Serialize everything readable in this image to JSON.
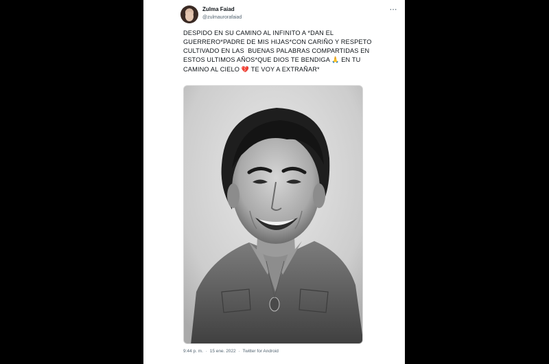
{
  "tweet": {
    "display_name": "Zulma Faiad",
    "handle": "@zulmaurorafaiad",
    "more_icon": "more-dots-icon",
    "text": "DESPIDO EN SU CAMINO AL INFINITO A *DAN EL GUERRERO*PADRE DE MIS HIJAS*CON CARIÑO Y RESPETO CULTIVADO EN LAS  BUENAS PALABRAS COMPARTIDAS EN ESTOS ULTIMOS AÑOS*QUE DIOS TE BENDIGA 🙏 EN TU CAMINO AL CIELO 💔 TE VOY A EXTRAÑAR*",
    "text_parts": {
      "part1": "DESPIDO EN SU CAMINO AL INFINITO A *DAN EL GUERRERO*PADRE DE MIS HIJAS*CON CARIÑO Y RESPETO CULTIVADO EN LAS  BUENAS PALABRAS COMPARTIDAS EN ESTOS ULTIMOS AÑOS*QUE DIOS TE BENDIGA ",
      "emoji1": "🙏",
      "part2": " EN TU CAMINO AL CIELO ",
      "emoji2": "💔",
      "part3": " TE VOY A EXTRAÑAR*"
    },
    "time": "9:44 p. m.",
    "date": "15 ene. 2022",
    "separator": "·",
    "source": "Twitter for Android"
  },
  "media": {
    "kind": "photo",
    "icon": "portrait-photo-icon"
  },
  "colors": {
    "background": "#000000",
    "card": "#ffffff",
    "text": "#0f1419",
    "muted": "#536471"
  }
}
